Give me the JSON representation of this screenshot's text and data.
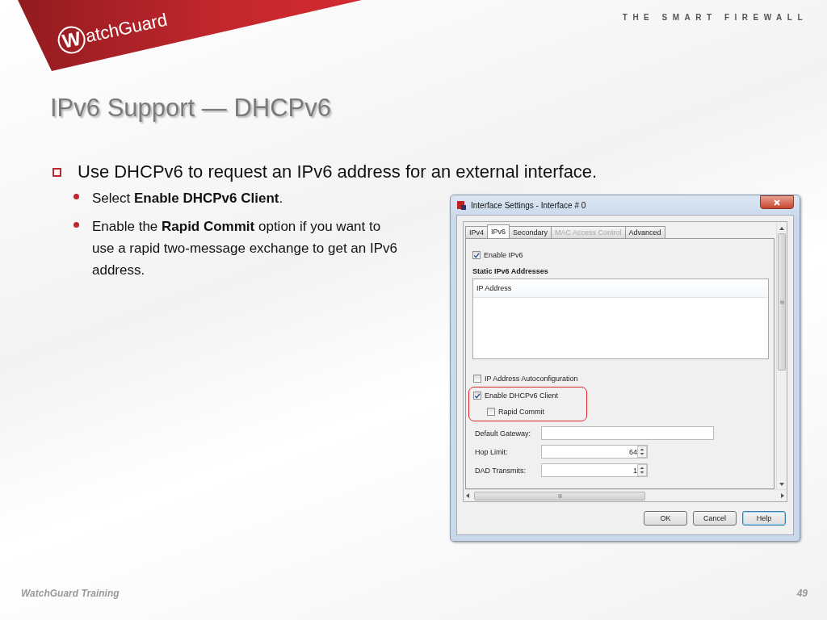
{
  "header": {
    "logo_mark": "W",
    "logo_text": "atchGuard",
    "tagline": "THE SMART FIREWALL",
    "title": "IPv6 Support — DHCPv6"
  },
  "bullets": [
    {
      "text": "Use DHCPv6 to request an IPv6 address for an external interface.",
      "children": [
        {
          "text": "Select **Enable DHCPv6 Client**."
        },
        {
          "text": "Enable the **Rapid Commit** option if you want to use a rapid two-message exchange to get an IPv6 address."
        }
      ]
    }
  ],
  "dialog": {
    "title": "Interface Settings - Interface # 0",
    "tabs": [
      {
        "label": "IPv4",
        "selected": false,
        "disabled": false
      },
      {
        "label": "IPv6",
        "selected": true,
        "disabled": false
      },
      {
        "label": "Secondary",
        "selected": false,
        "disabled": false
      },
      {
        "label": "MAC Access Control",
        "selected": false,
        "disabled": true
      },
      {
        "label": "Advanced",
        "selected": false,
        "disabled": false
      }
    ],
    "enable_ipv6": {
      "label": "Enable IPv6",
      "checked": true
    },
    "section_heading": "Static IPv6 Addresses",
    "table": {
      "columns": [
        "IP Address"
      ]
    },
    "options": [
      {
        "label": "IP Address Autoconfiguration",
        "checked": false,
        "highlighted": false
      },
      {
        "label": "Enable DHCPv6 Client",
        "checked": true,
        "highlighted": true,
        "children": [
          {
            "label": "Rapid Commit",
            "checked": false,
            "highlighted": false
          }
        ]
      }
    ],
    "fields": [
      {
        "label": "Default Gateway:",
        "kind": "text"
      },
      {
        "label": "Hop Limit:",
        "kind": "spinner",
        "value": "64"
      },
      {
        "label": "DAD Transmits:",
        "kind": "spinner",
        "value": "1"
      }
    ],
    "buttons": [
      {
        "label": "OK",
        "focused": false
      },
      {
        "label": "Cancel",
        "focused": false
      },
      {
        "label": "Help",
        "focused": true
      }
    ]
  },
  "footer": {
    "text": "WatchGuard Training",
    "page": "49"
  }
}
